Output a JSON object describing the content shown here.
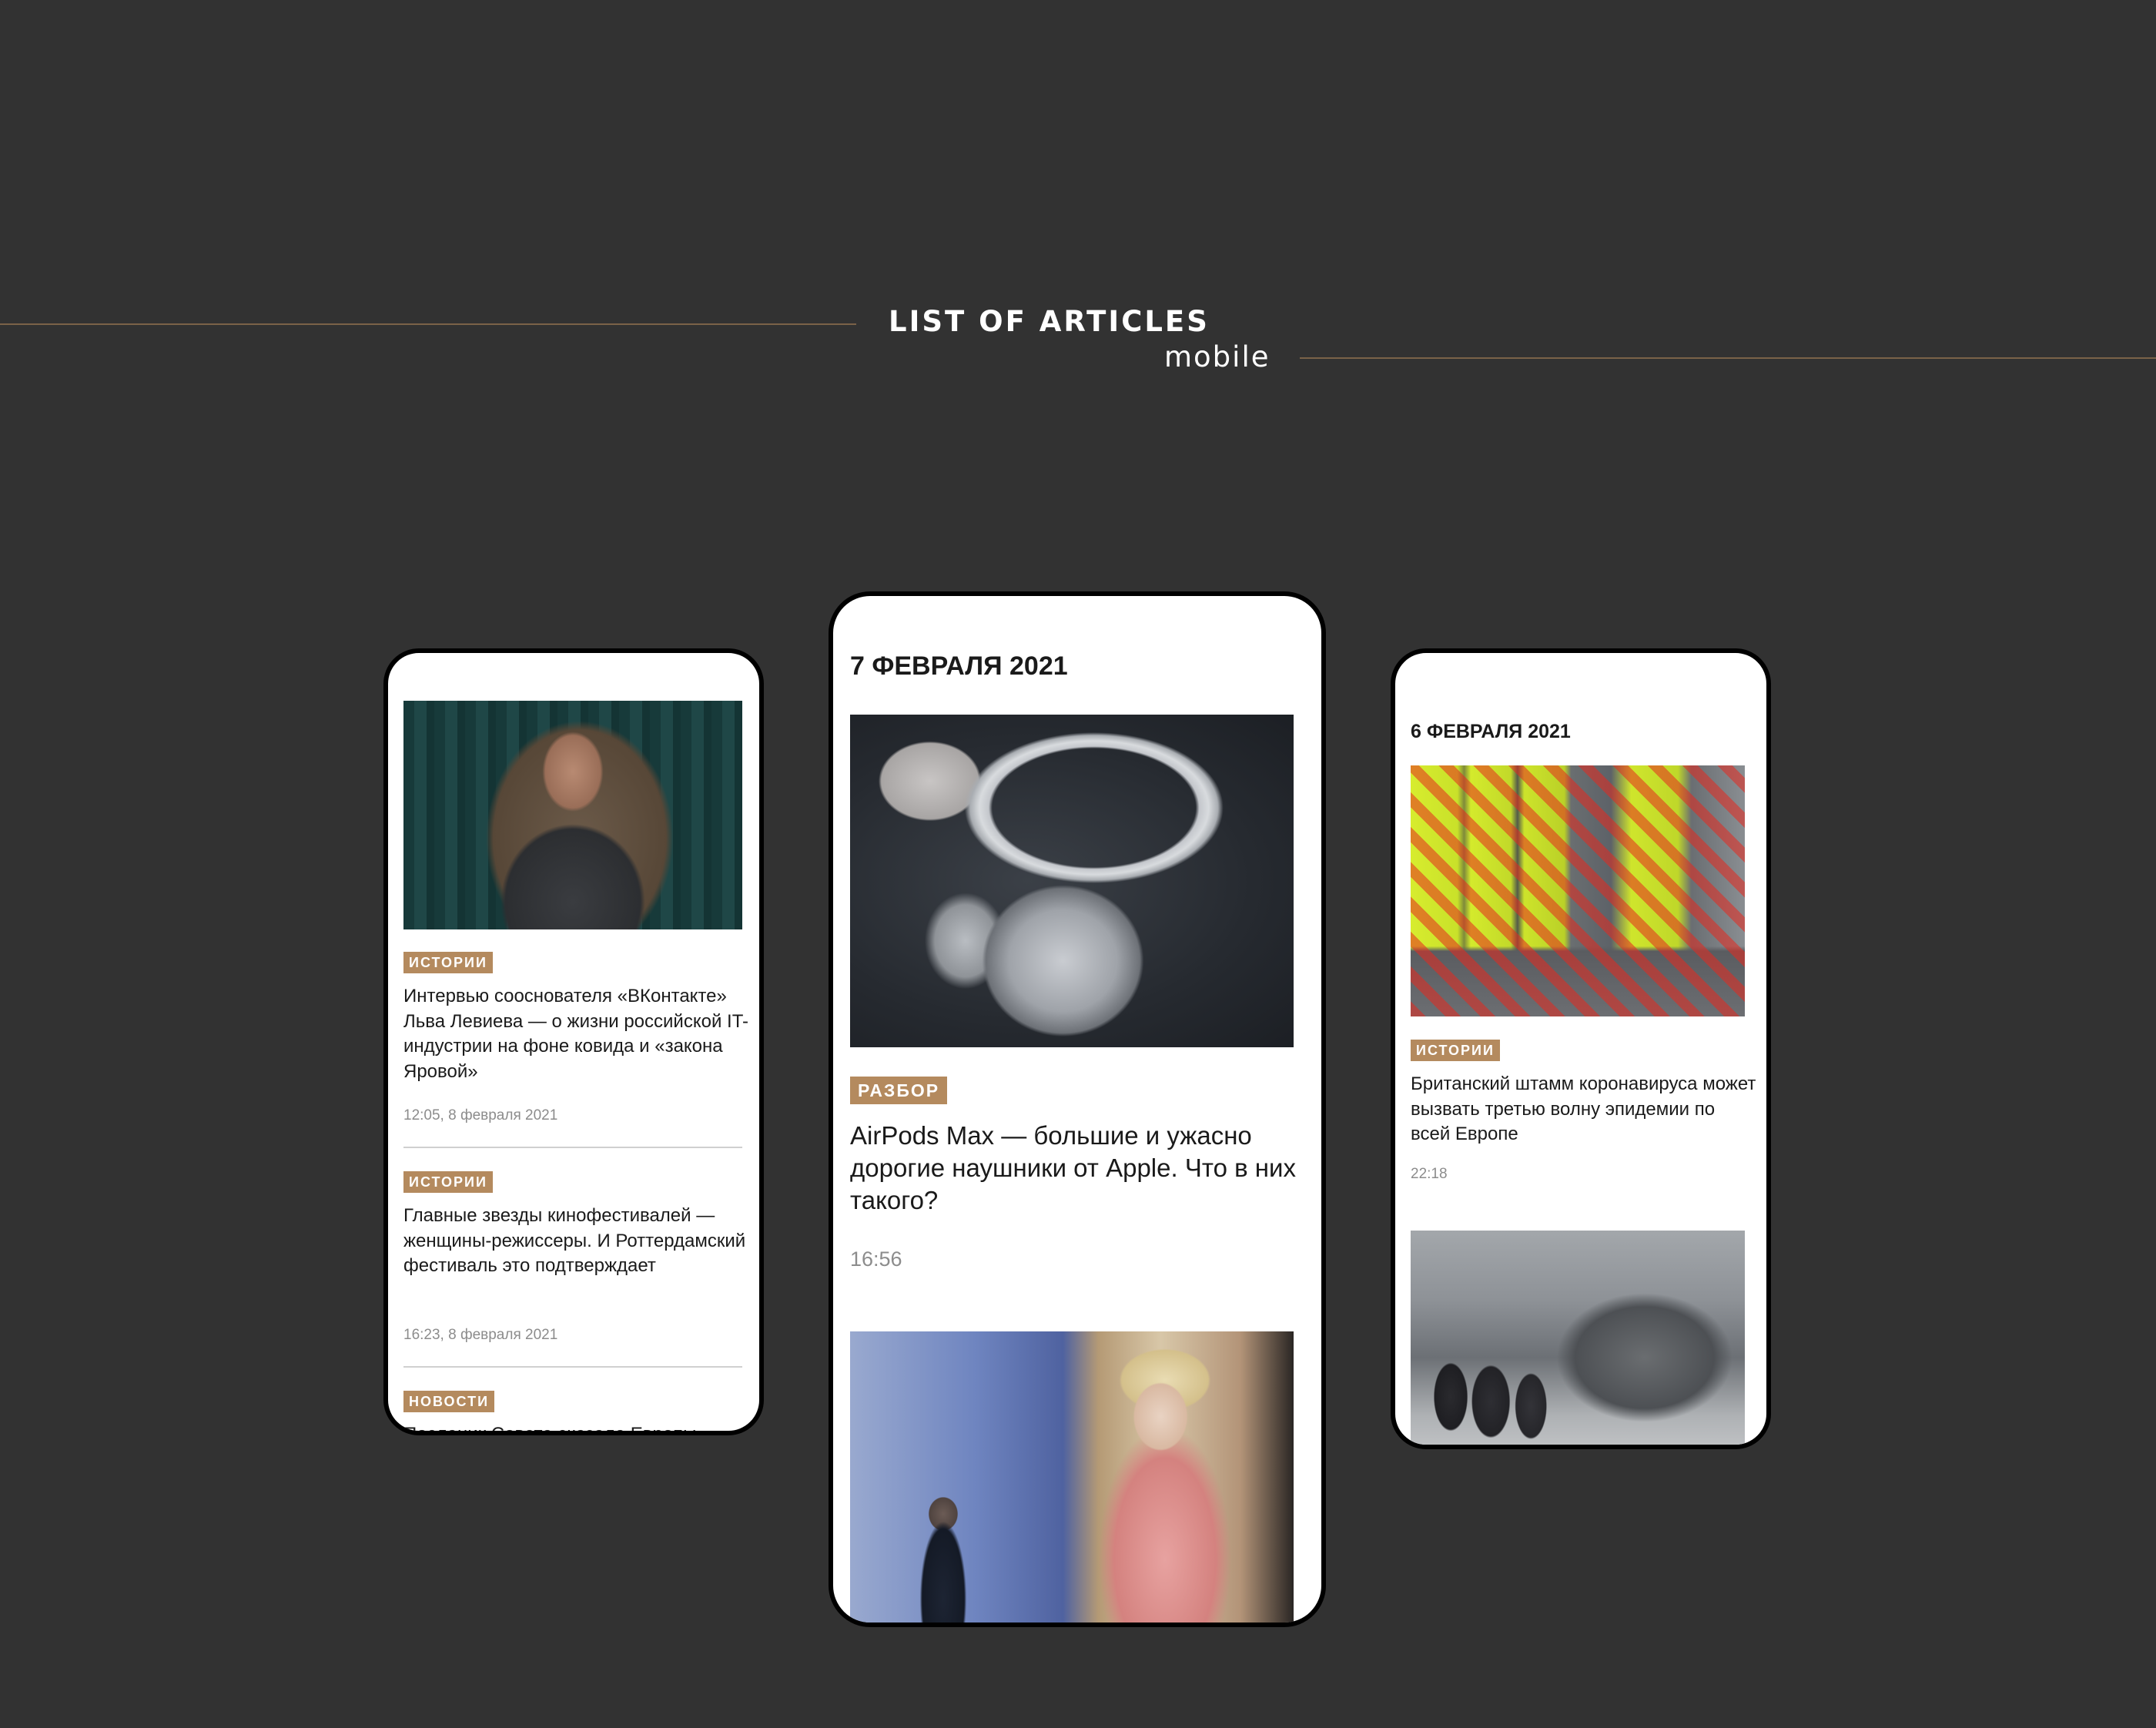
{
  "header": {
    "title": "LIST OF ARTICLES",
    "subtitle": "mobile"
  },
  "colors": {
    "background": "#323232",
    "accent": "#b48a5e",
    "text": "#1a1a1a",
    "meta": "#8c8c8c"
  },
  "phone_left": {
    "articles": [
      {
        "tag": "ИСТОРИИ",
        "title": "Интервью сооснователя «ВКонтакте» Льва Левиева — о жизни российской IT-индустрии на фоне ковида и «закона Яровой»",
        "meta": "12:05, 8 февраля 2021"
      },
      {
        "tag": "ИСТОРИИ",
        "title": "Главные звезды кинофестивалей — женщины-режиссеры. И Роттердамский фестиваль это подтверждает",
        "meta": "16:23, 8 февраля 2021"
      },
      {
        "tag": "НОВОСТИ",
        "title": "Посланик Совета сказала Европы"
      }
    ]
  },
  "phone_center": {
    "date": "7 ФЕВРАЛЯ 2021",
    "articles": [
      {
        "tag": "РАЗБОР",
        "title": "AirPods Max — большие и ужасно дорогие наушники от Apple. Что в них такого?",
        "meta": "16:56"
      }
    ]
  },
  "phone_right": {
    "date": "6 ФЕВРАЛЯ 2021",
    "articles": [
      {
        "tag": "ИСТОРИИ",
        "title": "Британский штамм коронавируса может вызвать третью волну эпидемии по всей Европе",
        "meta": "22:18"
      }
    ]
  }
}
